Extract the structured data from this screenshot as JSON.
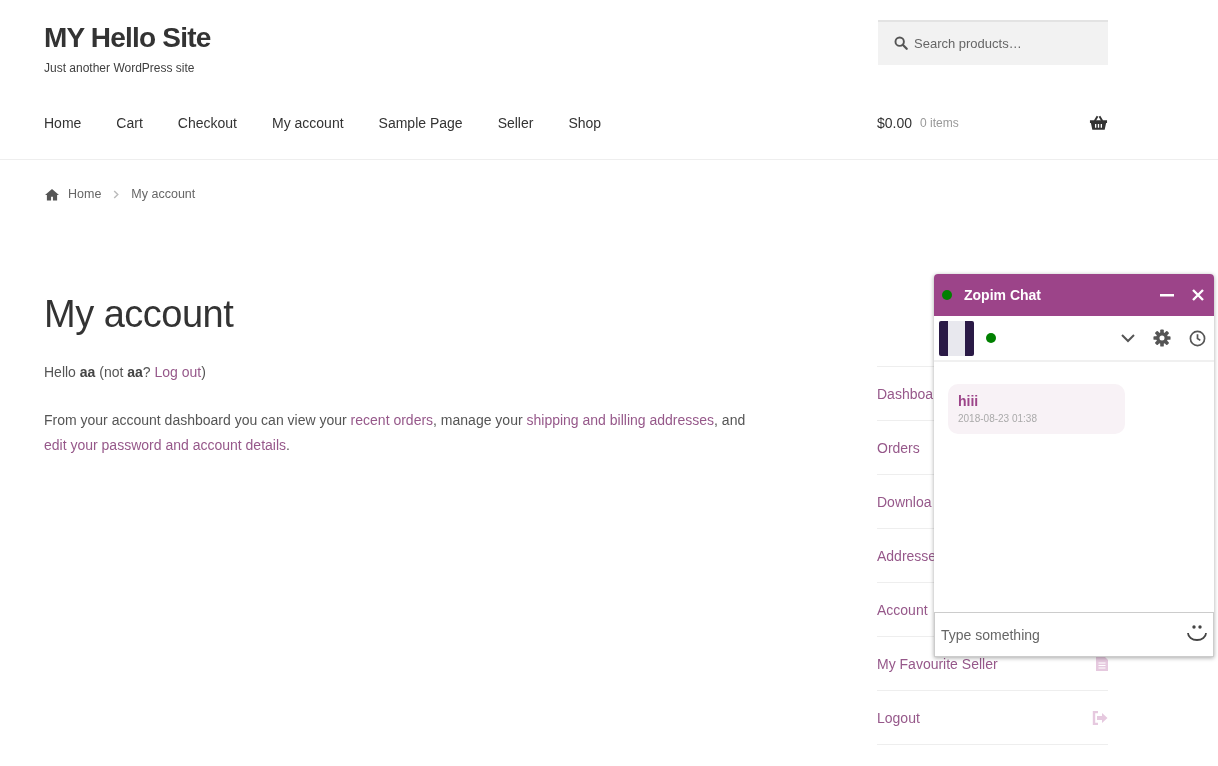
{
  "site": {
    "title": "MY Hello Site",
    "tagline": "Just another WordPress site"
  },
  "search": {
    "placeholder": "Search products…"
  },
  "nav": [
    "Home",
    "Cart",
    "Checkout",
    "My account",
    "Sample Page",
    "Seller",
    "Shop"
  ],
  "cart": {
    "amount": "$0.00",
    "count": "0 items"
  },
  "breadcrumb": [
    "Home",
    "My account"
  ],
  "page_title": "My account",
  "paragraphs": [
    [
      {
        "kind": "text",
        "text": "Hello "
      },
      {
        "kind": "bold",
        "text": "aa"
      },
      {
        "kind": "text",
        "text": " (not "
      },
      {
        "kind": "bold",
        "text": "aa"
      },
      {
        "kind": "text",
        "text": "? "
      },
      {
        "kind": "link",
        "text": "Log out"
      },
      {
        "kind": "text",
        "text": ")"
      }
    ],
    [
      {
        "kind": "text",
        "text": "From your account dashboard you can view your "
      },
      {
        "kind": "link",
        "text": "recent orders"
      },
      {
        "kind": "text",
        "text": ", manage your "
      },
      {
        "kind": "link",
        "text": "shipping and billing addresses"
      },
      {
        "kind": "text",
        "text": ", and "
      },
      {
        "kind": "link",
        "text": "edit your password and account details"
      },
      {
        "kind": "text",
        "text": "."
      }
    ]
  ],
  "account_nav": [
    {
      "label": "Dashboa",
      "kind": "plain"
    },
    {
      "label": "Orders",
      "kind": "plain"
    },
    {
      "label": "Downloa",
      "kind": "plain"
    },
    {
      "label": "Addresse",
      "kind": "plain"
    },
    {
      "label": "Account",
      "kind": "plain"
    },
    {
      "label": "My Favourite Seller",
      "kind": "file"
    },
    {
      "label": "Logout",
      "kind": "logout"
    }
  ],
  "chat": {
    "title": "Zopim Chat",
    "online": true,
    "agent_online": true,
    "messages": [
      {
        "text": "hiii",
        "time": "2018-08-23 01:38"
      }
    ],
    "input": {
      "placeholder": "Type something"
    }
  }
}
